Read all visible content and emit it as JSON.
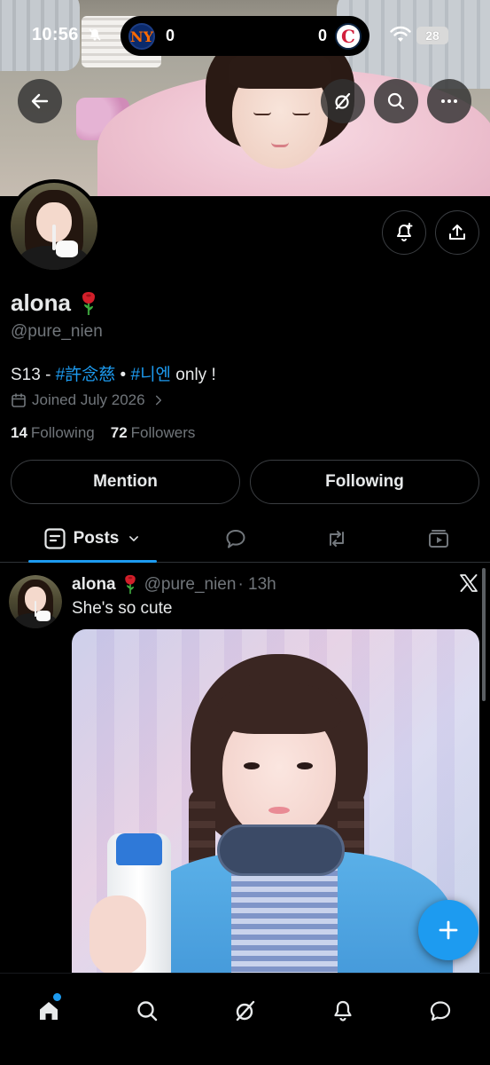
{
  "status_bar": {
    "time": "10:56",
    "score_left": "0",
    "score_right": "0",
    "team_left_logo": "NY",
    "team_right_logo": "C",
    "battery": "28"
  },
  "profile": {
    "display_name": "alona",
    "handle": "@pure_nien",
    "bio_prefix": "S13 - ",
    "bio_tag1": "#許念慈",
    "bio_sep": " • ",
    "bio_tag2": "#니엔",
    "bio_suffix": " only !",
    "joined": "Joined July 2026",
    "following_count": "14",
    "following_label": "Following",
    "followers_count": "72",
    "followers_label": "Followers",
    "mention_button": "Mention",
    "following_button": "Following"
  },
  "tabs": {
    "posts_label": "Posts"
  },
  "post": {
    "author": "alona",
    "handle": "@pure_nien",
    "time": "· 13h",
    "text": "She's so cute"
  },
  "colors": {
    "accent": "#1d9bf0",
    "background": "#000000",
    "secondary_text": "#71767b",
    "primary_text": "#e7e9ea"
  },
  "icons": {
    "back": "arrow-left-icon",
    "grok": "grok-icon",
    "search": "search-icon",
    "more": "more-icon",
    "notify": "bell-plus-icon",
    "share": "share-icon",
    "calendar": "calendar-icon",
    "replies": "speech-bubble-icon",
    "reposts": "repost-icon",
    "media": "media-icon",
    "x": "x-logo-icon",
    "compose": "plus-icon",
    "nav_home": "home-icon",
    "nav_search": "search-icon",
    "nav_grok": "grok-icon",
    "nav_notifications": "bell-icon",
    "nav_messages": "message-icon"
  }
}
